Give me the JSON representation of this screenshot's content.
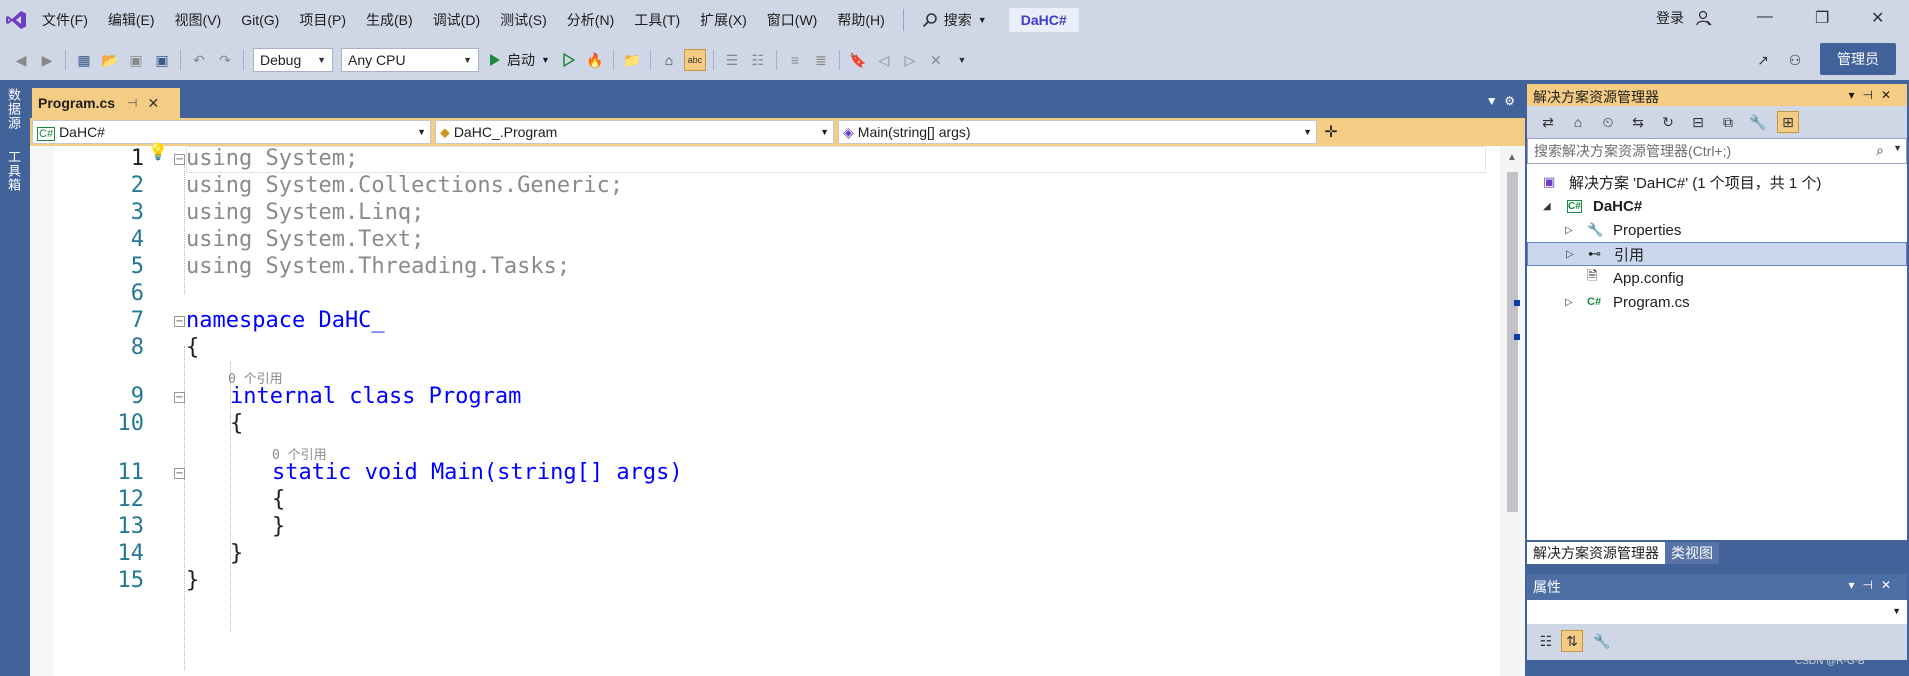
{
  "titlebar": {
    "menus": [
      "文件(F)",
      "编辑(E)",
      "视图(V)",
      "Git(G)",
      "项目(P)",
      "生成(B)",
      "调试(D)",
      "测试(S)",
      "分析(N)",
      "工具(T)",
      "扩展(X)",
      "窗口(W)",
      "帮助(H)"
    ],
    "search_label": "搜索",
    "solution_name": "DaHC#",
    "login": "登录"
  },
  "toolbar": {
    "config": "Debug",
    "platform": "Any CPU",
    "start_label": "启动",
    "admin_label": "管理员"
  },
  "left_strip": {
    "tabs": [
      "数据源",
      "工具箱"
    ]
  },
  "editor": {
    "tab_title": "Program.cs",
    "nav": {
      "project": "DaHC#",
      "class": "DaHC_.Program",
      "member": "Main(string[] args)"
    },
    "references_hint": "0 个引用",
    "lines": [
      {
        "n": "1",
        "text": "using System;"
      },
      {
        "n": "2",
        "text": "using System.Collections.Generic;"
      },
      {
        "n": "3",
        "text": "using System.Linq;"
      },
      {
        "n": "4",
        "text": "using System.Text;"
      },
      {
        "n": "5",
        "text": "using System.Threading.Tasks;"
      },
      {
        "n": "6",
        "text": ""
      },
      {
        "n": "7",
        "text": "namespace DaHC_"
      },
      {
        "n": "8",
        "text": "{"
      },
      {
        "n": "9",
        "text": "internal class Program"
      },
      {
        "n": "10",
        "text": "{"
      },
      {
        "n": "11",
        "text": "static void Main(string[] args)"
      },
      {
        "n": "12",
        "text": "{"
      },
      {
        "n": "13",
        "text": "}"
      },
      {
        "n": "14",
        "text": "}"
      },
      {
        "n": "15",
        "text": "}"
      }
    ]
  },
  "solution_explorer": {
    "title": "解决方案资源管理器",
    "search_placeholder": "搜索解决方案资源管理器(Ctrl+;)",
    "nodes": [
      {
        "label": "解决方案 'DaHC#' (1 个项目，共 1 个)"
      },
      {
        "label": "DaHC#"
      },
      {
        "label": "Properties"
      },
      {
        "label": "引用"
      },
      {
        "label": "App.config"
      },
      {
        "label": "Program.cs"
      }
    ],
    "bottom_tabs": [
      "解决方案资源管理器",
      "类视图"
    ]
  },
  "properties": {
    "title": "属性"
  },
  "watermark": "CSDN @R-G-B",
  "colors": {
    "accent": "#41639a",
    "active_tab": "#f5cc84",
    "keyword": "#0000ff",
    "type": "#2b91af"
  }
}
